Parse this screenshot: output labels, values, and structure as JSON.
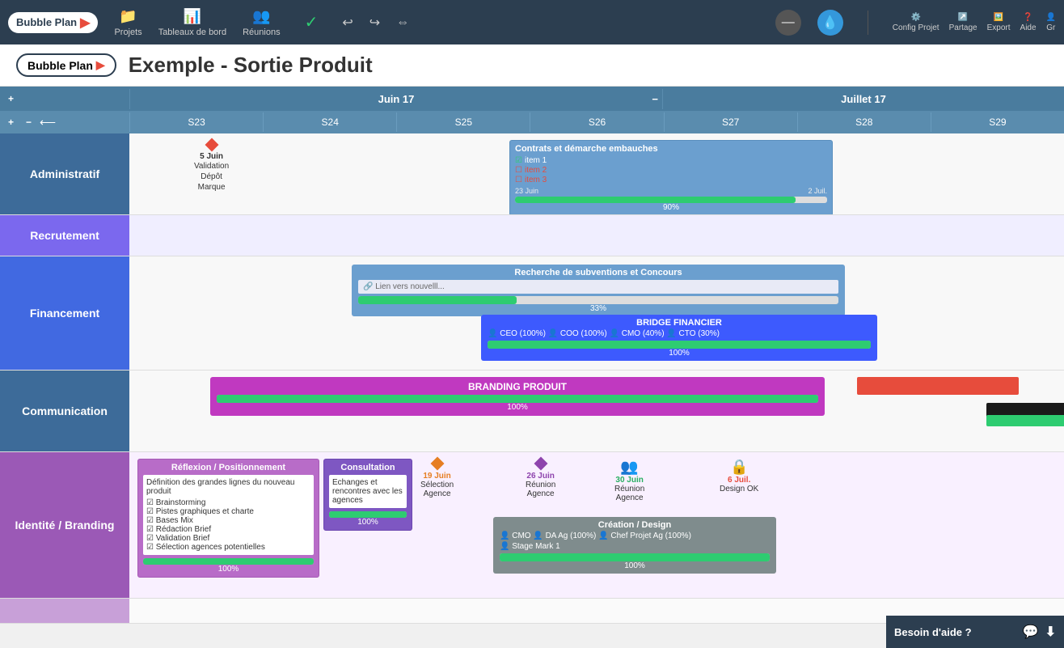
{
  "app": {
    "name": "Bubble Plan",
    "title": "Exemple - Sortie Produit"
  },
  "nav": {
    "logo": "Bubble Plan",
    "items": [
      {
        "label": "Projets",
        "icon": "📁"
      },
      {
        "label": "Tableaux de bord",
        "icon": "📊"
      },
      {
        "label": "Réunions",
        "icon": "👥"
      }
    ],
    "right_items": [
      {
        "label": "Config Projet",
        "icon": "⚙️"
      },
      {
        "label": "Partage",
        "icon": "↗️"
      },
      {
        "label": "Export",
        "icon": "🖼️"
      },
      {
        "label": "Aide",
        "icon": "❓"
      },
      {
        "label": "Gr",
        "icon": ""
      }
    ]
  },
  "months": [
    {
      "label": "Juin 17",
      "span": 4
    },
    {
      "label": "Juillet 17",
      "span": 3
    }
  ],
  "weeks": [
    "S23",
    "S24",
    "S25",
    "S26",
    "S27",
    "S28",
    "S29"
  ],
  "rows": [
    {
      "id": "administratif",
      "label": "Administratif",
      "color": "color-admin"
    },
    {
      "id": "recrutement",
      "label": "Recrutement",
      "color": "color-recrutement"
    },
    {
      "id": "financement",
      "label": "Financement",
      "color": "color-financement",
      "tall": true
    },
    {
      "id": "communication",
      "label": "Communication",
      "color": "color-communication"
    },
    {
      "id": "identite",
      "label": "Identité / Branding",
      "color": "color-identite",
      "tall": true
    }
  ],
  "tasks": {
    "administratif": {
      "milestone": {
        "date": "5 Juin",
        "label": "Validation\nDépôt\nMarque",
        "type": "red"
      },
      "task_box": {
        "title": "Contrats et démarche embauches",
        "items": [
          {
            "label": "item 1",
            "checked": true,
            "color": "white"
          },
          {
            "label": "item 2",
            "checked": false,
            "color": "red"
          },
          {
            "label": "item 3",
            "checked": false,
            "color": "red"
          }
        ],
        "date_start": "23 Juin",
        "date_end": "2 Juil.",
        "progress": 90
      }
    },
    "financement": {
      "task1": {
        "title": "Recherche de subventions et Concours",
        "note": "Lien vers nouvelll...",
        "progress": 33,
        "color": "#6b9fcf"
      },
      "task2": {
        "title": "BRIDGE FINANCIER",
        "people": [
          "CEO (100%)",
          "COO (100%)",
          "CMO (40%)",
          "CTO (30%)"
        ],
        "progress": 100,
        "color": "#3d5afe"
      }
    },
    "communication": {
      "branding": {
        "title": "BRANDING PRODUIT",
        "progress": 100,
        "color": "#c039c0"
      }
    },
    "identite": {
      "task_reflexion": {
        "title": "Réflexion / Positionnement",
        "description": "Définition des grandes lignes du nouveau produit",
        "items": [
          "Brainstorming",
          "Pistes graphiques et charte",
          "Bases Mix",
          "Rédaction Brief",
          "Validation Brief",
          "Sélection agences potentielles"
        ],
        "progress": 100,
        "color": "#b86cc8"
      },
      "task_consultation": {
        "title": "Consultation",
        "description": "Echanges et rencontres avec les agences",
        "progress": 100,
        "color": "#7e57c2"
      },
      "milestone_selection": {
        "date": "19 Juin",
        "label": "Sélection\nAgence",
        "type": "orange"
      },
      "milestone_reunion1": {
        "date": "26 Juin",
        "label": "Réunion\nAgence",
        "type": "purple"
      },
      "milestone_reunion2": {
        "date": "30 Juin",
        "label": "Réunion\nAgence",
        "type": "reunion"
      },
      "milestone_design": {
        "date": "6 Juil.",
        "label": "Design OK",
        "type": "lock"
      },
      "task_creation": {
        "title": "Création / Design",
        "people": [
          "CMO",
          "DA Ag (100%)",
          "Chef Projet Ag (100%)",
          "Stage Mark 1"
        ],
        "progress": 100,
        "color": "#7f8c8d"
      }
    }
  },
  "help": {
    "label": "Besoin d'aide ?"
  }
}
